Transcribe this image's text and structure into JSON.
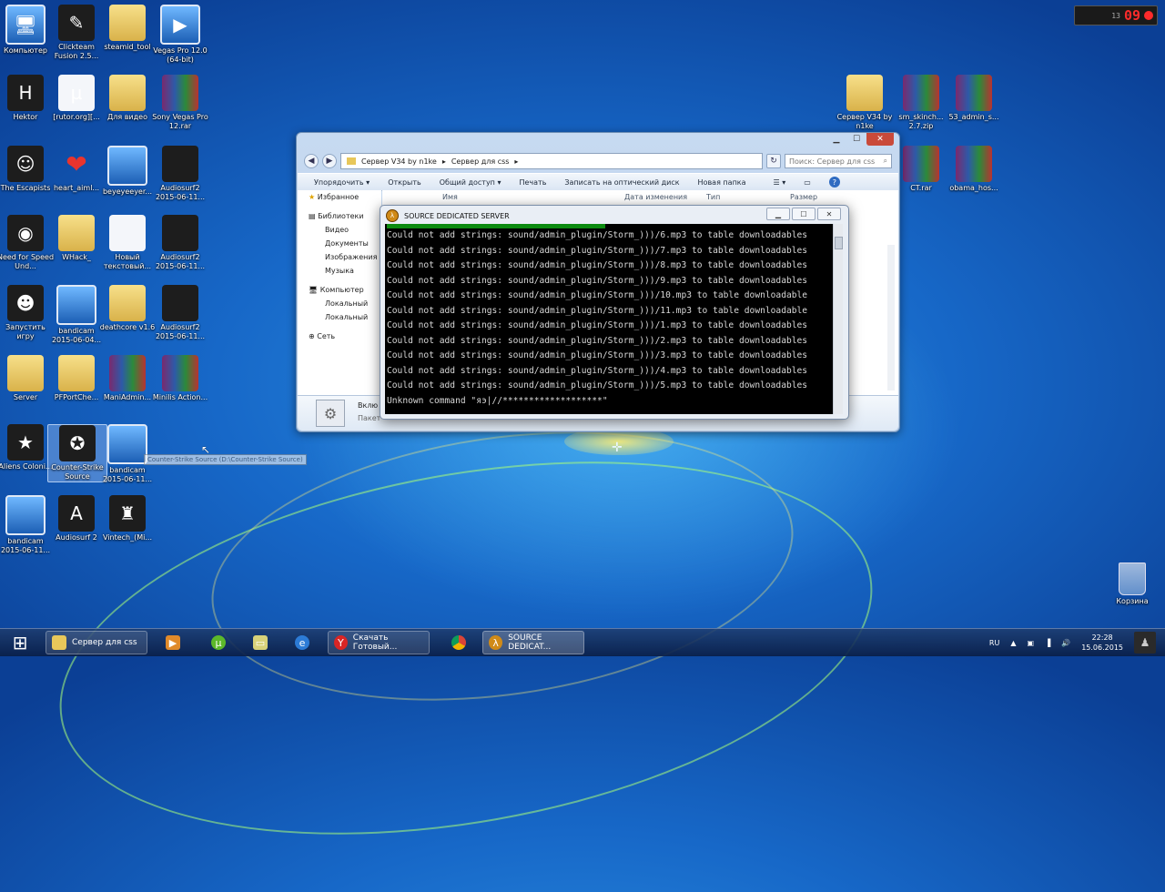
{
  "desktop": {
    "icons": [
      {
        "id": "computer",
        "label": "Компьютер",
        "glyph": "🖥"
      },
      {
        "id": "clickteam",
        "label": "Clickteam Fusion 2.5...",
        "glyph": "✎"
      },
      {
        "id": "steamid",
        "label": "steamid_tool",
        "glyph": ""
      },
      {
        "id": "vegas",
        "label": "Vegas Pro 12.0 (64-bit)",
        "glyph": "▶"
      },
      {
        "id": "hektor",
        "label": "Hektor",
        "glyph": "H"
      },
      {
        "id": "rutor",
        "label": "[rutor.org][...",
        "glyph": "µ"
      },
      {
        "id": "video",
        "label": "Для видео",
        "glyph": ""
      },
      {
        "id": "sonyrar",
        "label": "Sony Vegas Pro 12.rar",
        "glyph": ""
      },
      {
        "id": "escapists",
        "label": "The Escapists",
        "glyph": "☺"
      },
      {
        "id": "heart",
        "label": "heart_aiml...",
        "glyph": "❤"
      },
      {
        "id": "beyeey",
        "label": "beyeyeeyer...",
        "glyph": ""
      },
      {
        "id": "audiosurf1",
        "label": "Audiosurf2 2015-06-11...",
        "glyph": ""
      },
      {
        "id": "nfs",
        "label": "Need for Speed Und...",
        "glyph": "◉"
      },
      {
        "id": "whack",
        "label": "WHack_",
        "glyph": ""
      },
      {
        "id": "newtext",
        "label": "Новый текстовый...",
        "glyph": ""
      },
      {
        "id": "audiosurf2",
        "label": "Audiosurf2 2015-06-11...",
        "glyph": ""
      },
      {
        "id": "launch",
        "label": "Запустить игру",
        "glyph": "☻"
      },
      {
        "id": "bandicam1",
        "label": "bandicam 2015-06-04...",
        "glyph": ""
      },
      {
        "id": "deathcore",
        "label": "deathcore v1.6",
        "glyph": ""
      },
      {
        "id": "audiosurf3",
        "label": "Audiosurf2 2015-06-11...",
        "glyph": ""
      },
      {
        "id": "server",
        "label": "Server",
        "glyph": ""
      },
      {
        "id": "pfport",
        "label": "PFPortChe...",
        "glyph": ""
      },
      {
        "id": "maniadmin",
        "label": "ManiAdmin...",
        "glyph": ""
      },
      {
        "id": "minilis",
        "label": "Minilis Action...",
        "glyph": ""
      },
      {
        "id": "aliens",
        "label": "Aliens Coloni...",
        "glyph": "★"
      },
      {
        "id": "css",
        "label": "Counter-Strike Source",
        "glyph": "✪"
      },
      {
        "id": "bandicam2",
        "label": "bandicam 2015-06-11...",
        "glyph": ""
      },
      {
        "id": "bandicam3",
        "label": "bandicam 2015-06-11...",
        "glyph": ""
      },
      {
        "id": "audiosurf2app",
        "label": "Audiosurf 2",
        "glyph": "A"
      },
      {
        "id": "vintech",
        "label": "Vintech_(Mi...",
        "glyph": "♜"
      }
    ],
    "right_icons": [
      {
        "id": "serverv34",
        "label": "Сервер V34 by n1ke"
      },
      {
        "id": "smskinch",
        "label": "sm_skinch... 2.7.zip"
      },
      {
        "id": "s3admin",
        "label": "53_admin_s..."
      },
      {
        "id": "ctrar",
        "label": "CT.rar"
      },
      {
        "id": "obama",
        "label": "obama_hos..."
      },
      {
        "id": "recycle",
        "label": "Корзина"
      }
    ],
    "tooltip": "Counter-Strike Source (D:\\Counter-Strike Source)"
  },
  "clock_widget": {
    "small": "13",
    "digits": "09"
  },
  "explorer": {
    "breadcrumb": [
      "Сервер V34 by n1ke",
      "Сервер для css"
    ],
    "search_placeholder": "Поиск: Сервер для css",
    "toolbar": [
      "Упорядочить ▾",
      "Открыть",
      "Общий доступ ▾",
      "Печать",
      "Записать на оптический диск",
      "Новая папка"
    ],
    "nav": [
      {
        "label": "Избранное",
        "sub": false
      },
      {
        "label": "Библиотеки",
        "sub": false
      },
      {
        "label": "Видео",
        "sub": true
      },
      {
        "label": "Документы",
        "sub": true
      },
      {
        "label": "Изображения",
        "sub": true
      },
      {
        "label": "Музыка",
        "sub": true
      },
      {
        "label": "Компьютер",
        "sub": false
      },
      {
        "label": "Локальный",
        "sub": true
      },
      {
        "label": "Локальный",
        "sub": true
      },
      {
        "label": "Сеть",
        "sub": false
      }
    ],
    "columns": [
      "Имя",
      "Дата изменения",
      "Тип",
      "Размер"
    ],
    "details_label1": "Вклю",
    "details_label2": "Пакет"
  },
  "console": {
    "title": "SOURCE DEDICATED SERVER",
    "lines": [
      "Could not add strings: sound/admin_plugin/Storm_)))/6.mp3 to table downloadables",
      "Could not add strings: sound/admin_plugin/Storm_)))/7.mp3 to table downloadables",
      "Could not add strings: sound/admin_plugin/Storm_)))/8.mp3 to table downloadables",
      "Could not add strings: sound/admin_plugin/Storm_)))/9.mp3 to table downloadables",
      "Could not add strings: sound/admin_plugin/Storm_)))/10.mp3 to table downloadable",
      "Could not add strings: sound/admin_plugin/Storm_)))/11.mp3 to table downloadable",
      "Could not add strings: sound/admin_plugin/Storm_)))/1.mp3 to table downloadables",
      "Could not add strings: sound/admin_plugin/Storm_)))/2.mp3 to table downloadables",
      "Could not add strings: sound/admin_plugin/Storm_)))/3.mp3 to table downloadables",
      "Could not add strings: sound/admin_plugin/Storm_)))/4.mp3 to table downloadables",
      "Could not add strings: sound/admin_plugin/Storm_)))/5.mp3 to table downloadables",
      "Unknown command \"яэ|//*******************\""
    ]
  },
  "taskbar": {
    "items": [
      {
        "id": "explorer",
        "label": "Сервер для css",
        "wide": true
      },
      {
        "id": "media",
        "label": "",
        "wide": false
      },
      {
        "id": "utorrent",
        "label": "",
        "wide": false
      },
      {
        "id": "files",
        "label": "",
        "wide": false
      },
      {
        "id": "ie",
        "label": "",
        "wide": false
      },
      {
        "id": "yandex",
        "label": "Скачать Готовый...",
        "wide": true
      },
      {
        "id": "chrome",
        "label": "",
        "wide": false
      },
      {
        "id": "srcds",
        "label": "SOURCE DEDICAT...",
        "wide": true
      }
    ],
    "lang": "RU",
    "time": "22:28",
    "date": "15.06.2015"
  }
}
